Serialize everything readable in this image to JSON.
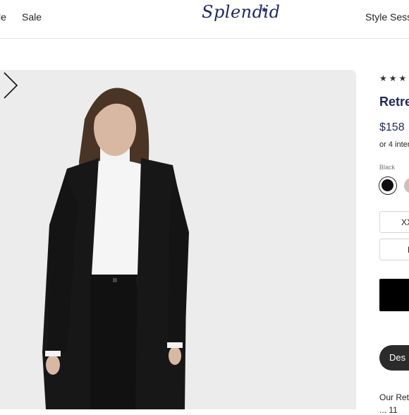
{
  "header": {
    "nav_left": [
      "le",
      "Sale"
    ],
    "logo_text": "Splendid",
    "nav_right": "Style Sessio"
  },
  "product": {
    "rating_stars": "★★★",
    "title": "Retre",
    "price": "$158",
    "installments": "or 4 inter",
    "color_label": "Black",
    "colors": [
      {
        "name": "Black",
        "hex": "#120c14",
        "selected": true
      },
      {
        "name": "Tan",
        "hex": "#cfc2b2",
        "selected": false
      }
    ],
    "sizes": [
      "XX",
      "L"
    ],
    "description_tab": "Des",
    "description_line1": "Our Retr",
    "description_line2": "... 11"
  },
  "gallery": {
    "next_icon": "chevron-right-icon"
  }
}
